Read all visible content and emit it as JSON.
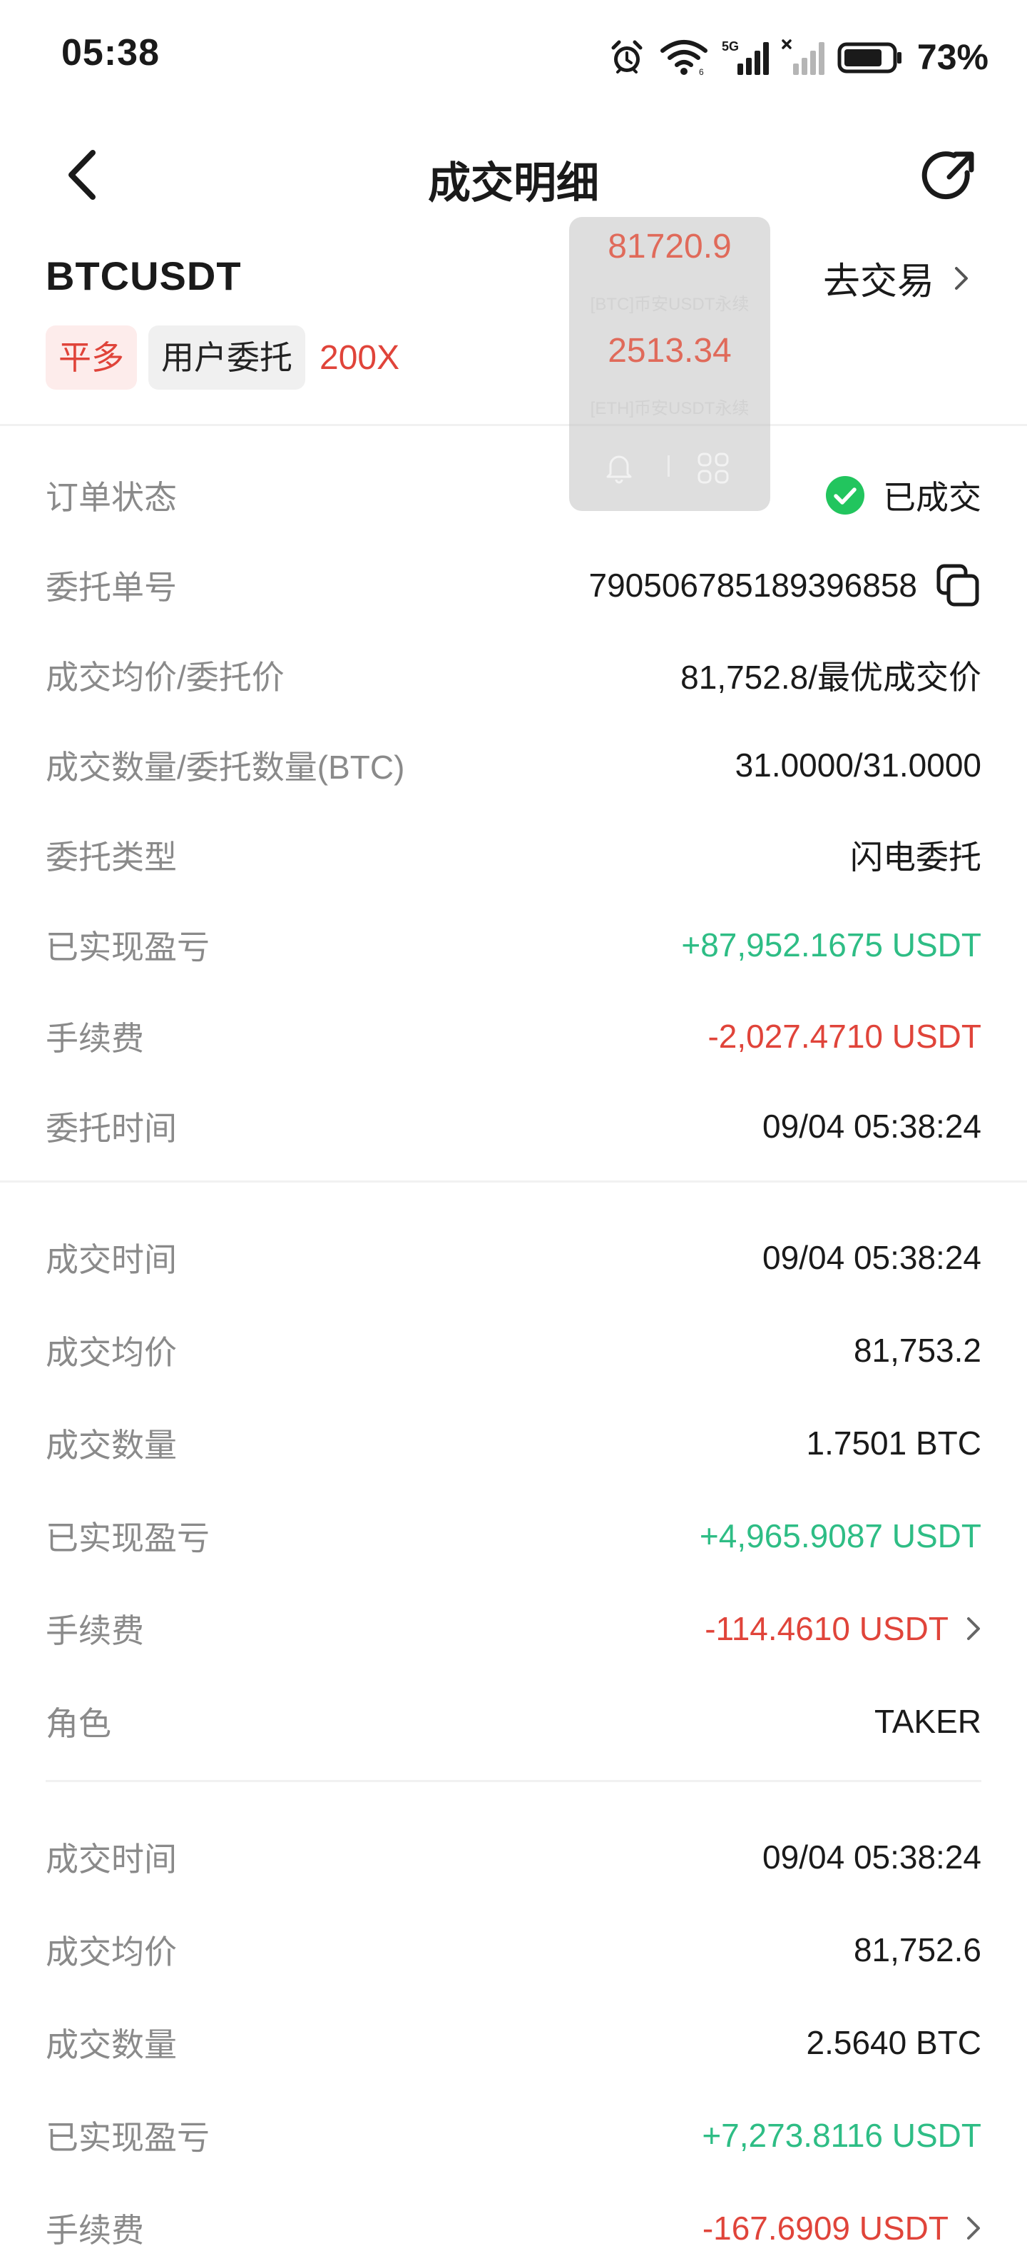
{
  "status_bar": {
    "time": "05:38",
    "battery": "73%",
    "icons": [
      "alarm-icon",
      "wifi-icon",
      "signal-5g-icon",
      "signal-icon",
      "battery-icon"
    ]
  },
  "nav": {
    "title": "成交明细",
    "back_icon": "back-arrow-icon",
    "share_icon": "share-icon"
  },
  "header": {
    "symbol": "BTCUSDT",
    "go_trade_label": "去交易",
    "tags": {
      "side": "平多",
      "order_type": "用户委托",
      "leverage": "200X"
    }
  },
  "order": {
    "status_label": "订单状态",
    "status_value": "已成交",
    "order_no_label": "委托单号",
    "order_no_value": "790506785189396858",
    "avg_price_label": "成交均价/委托价",
    "avg_price_value": "81,752.8/最优成交价",
    "qty_label": "成交数量/委托数量(BTC)",
    "qty_value": "31.0000/31.0000",
    "type_label": "委托类型",
    "type_value": "闪电委托",
    "pnl_label": "已实现盈亏",
    "pnl_value": "+87,952.1675 USDT",
    "fee_label": "手续费",
    "fee_value": "-2,027.4710 USDT",
    "time_label": "委托时间",
    "time_value": "09/04 05:38:24"
  },
  "fills": [
    {
      "time_label": "成交时间",
      "time_value": "09/04 05:38:24",
      "price_label": "成交均价",
      "price_value": "81,753.2",
      "qty_label": "成交数量",
      "qty_value": "1.7501 BTC",
      "pnl_label": "已实现盈亏",
      "pnl_value": "+4,965.9087 USDT",
      "fee_label": "手续费",
      "fee_value": "-114.4610 USDT",
      "role_label": "角色",
      "role_value": "TAKER"
    },
    {
      "time_label": "成交时间",
      "time_value": "09/04 05:38:24",
      "price_label": "成交均价",
      "price_value": "81,752.6",
      "qty_label": "成交数量",
      "qty_value": "2.5640 BTC",
      "pnl_label": "已实现盈亏",
      "pnl_value": "+7,273.8116 USDT",
      "fee_label": "手续费",
      "fee_value": "-167.6909 USDT"
    }
  ],
  "float_widget": {
    "price1": "81720.9",
    "label1": "[BTC]币安USDT永续",
    "price2": "2513.34",
    "label2": "[ETH]币安USDT永续"
  },
  "colors": {
    "green": "#2ebd85",
    "red": "#e0443a",
    "label_gray": "#8a8a8a",
    "check_green": "#22c55e"
  }
}
